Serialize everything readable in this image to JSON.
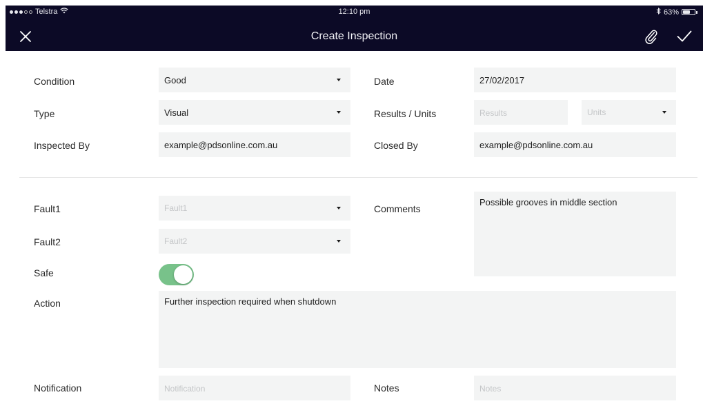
{
  "status_bar": {
    "carrier": "Telstra",
    "time": "12:10 pm",
    "battery": "63%",
    "battery_level": 0.63
  },
  "nav": {
    "title": "Create Inspection",
    "close_icon": "close-icon",
    "attach_icon": "paperclip-icon",
    "done_icon": "checkmark-icon"
  },
  "form": {
    "condition": {
      "label": "Condition",
      "value": "Good"
    },
    "type": {
      "label": "Type",
      "value": "Visual"
    },
    "inspected_by": {
      "label": "Inspected By",
      "value": "example@pdsonline.com.au"
    },
    "date": {
      "label": "Date",
      "value": "27/02/2017"
    },
    "results_units": {
      "label": "Results / Units",
      "results_placeholder": "Results",
      "units_placeholder": "Units"
    },
    "closed_by": {
      "label": "Closed By",
      "value": "example@pdsonline.com.au"
    },
    "fault1": {
      "label": "Fault1",
      "placeholder": "Fault1"
    },
    "fault2": {
      "label": "Fault2",
      "placeholder": "Fault2"
    },
    "safe": {
      "label": "Safe",
      "on": true
    },
    "comments": {
      "label": "Comments",
      "value": "Possible grooves in middle section"
    },
    "action": {
      "label": "Action",
      "value": "Further inspection required when shutdown"
    },
    "notification": {
      "label": "Notification",
      "placeholder": "Notification"
    },
    "notes": {
      "label": "Notes",
      "placeholder": "Notes"
    }
  },
  "colors": {
    "header_bg": "#0c0a26",
    "field_bg": "#f3f4f4",
    "toggle_on": "#78c28a"
  }
}
